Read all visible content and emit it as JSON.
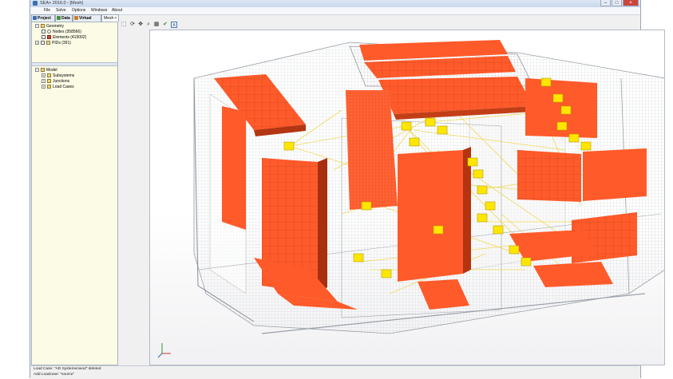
{
  "window": {
    "title": "SEA+ 2016.0 - [Mesh]",
    "controls": {
      "minimize": "–",
      "maximize": "□",
      "close": "×"
    }
  },
  "menu": [
    "File",
    "Solve",
    "Options",
    "Windows",
    "About"
  ],
  "tabs": [
    {
      "label": "Project",
      "color": "#3b6fb6"
    },
    {
      "label": "Data",
      "color": "#4a8f3d"
    },
    {
      "label": "Virtual SEA",
      "color": "#c97e2a"
    },
    {
      "label": "Mesh",
      "close": "×",
      "active": true,
      "color": "#7a7a7a"
    }
  ],
  "toolbar_icons": [
    "select-icon",
    "rotate-icon",
    "pan-icon",
    "zoom-icon",
    "fit-icon",
    "check-icon",
    "label-icon"
  ],
  "geometry_tree": {
    "root": "Geometry",
    "items": [
      {
        "label": "Nodes (358566)",
        "icon": "node"
      },
      {
        "label": "Elements (415002)",
        "icon": "elem"
      },
      {
        "label": "PIDs (391)",
        "icon": "pid"
      }
    ]
  },
  "model_tree": {
    "root": "Model",
    "items": [
      {
        "label": "Subsystems"
      },
      {
        "label": "Junctions"
      },
      {
        "label": "Load Cases"
      }
    ]
  },
  "status": {
    "line1": "Load Case: \"AD Systemenwod\" deleted",
    "line2": "Add Loadcase: \"source\""
  },
  "colors": {
    "panel": "#ff5a2a",
    "junction": "#ffea00",
    "junction_line": "#f0dc57",
    "mesh": "#b8bcc2"
  }
}
